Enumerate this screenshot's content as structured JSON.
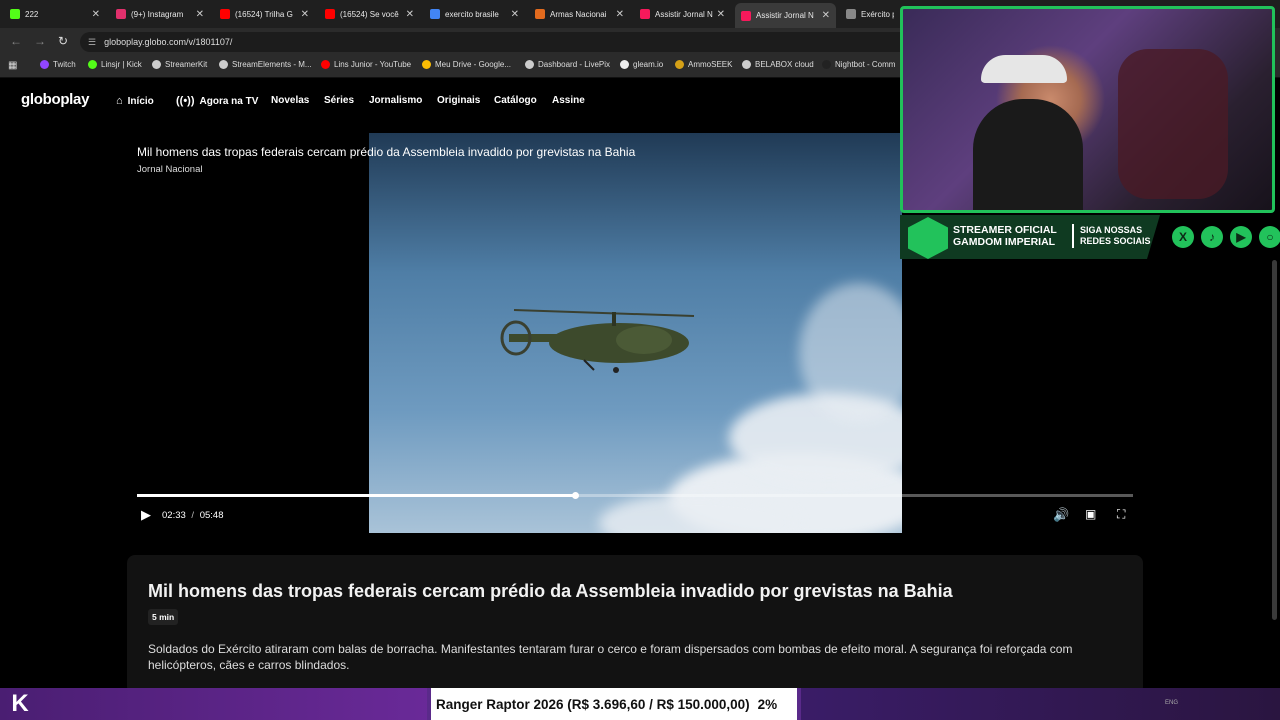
{
  "browser": {
    "tabs": [
      {
        "title": "222",
        "color": "#53fc18",
        "active": false
      },
      {
        "title": "(9+) Instagram",
        "color": "#e1306c",
        "active": false
      },
      {
        "title": "(16524) Trilha G",
        "color": "#ff0000",
        "active": false
      },
      {
        "title": "(16524) Se você",
        "color": "#ff0000",
        "active": false
      },
      {
        "title": "exercito brasile",
        "color": "#4285f4",
        "active": false
      },
      {
        "title": "Armas Nacionai",
        "color": "#e36b1e",
        "active": false
      },
      {
        "title": "Assistir Jornal N",
        "color": "#f7195b",
        "active": false
      },
      {
        "title": "Assistir Jornal N",
        "color": "#f7195b",
        "active": true
      },
      {
        "title": "Exército pa",
        "color": "#888888",
        "active": false
      }
    ],
    "url": "globoplay.globo.com/v/1801107/",
    "bookmarks": [
      {
        "label": "Twitch",
        "color": "#9146ff"
      },
      {
        "label": "Linsjr | Kick",
        "color": "#53fc18"
      },
      {
        "label": "StreamerKit",
        "color": "#cccccc"
      },
      {
        "label": "StreamElements - M...",
        "color": "#cccccc"
      },
      {
        "label": "Lins Junior - YouTube",
        "color": "#ff0000"
      },
      {
        "label": "Meu Drive - Google...",
        "color": "#fbbc04"
      },
      {
        "label": "Dashboard - LivePix",
        "color": "#cccccc"
      },
      {
        "label": "gleam.io",
        "color": "#eeeeee"
      },
      {
        "label": "AmmoSEEK",
        "color": "#d4a017"
      },
      {
        "label": "BELABOX cloud",
        "color": "#cccccc"
      },
      {
        "label": "Nightbot - Comm",
        "color": "#222222"
      }
    ]
  },
  "site": {
    "logo": "globoplay",
    "nav": [
      {
        "label": "Início",
        "icon": "home-icon"
      },
      {
        "label": "Agora na TV",
        "icon": "broadcast-icon"
      },
      {
        "label": "Novelas"
      },
      {
        "label": "Séries"
      },
      {
        "label": "Jornalismo"
      },
      {
        "label": "Originais"
      },
      {
        "label": "Catálogo"
      },
      {
        "label": "Assine"
      }
    ]
  },
  "player": {
    "title": "Mil homens das tropas federais cercam prédio da Assembleia invadido por grevistas na Bahia",
    "program": "Jornal Nacional",
    "current_time": "02:33",
    "separator": "/",
    "duration": "05:48",
    "progress": 0.44
  },
  "details": {
    "title": "Mil homens das tropas federais cercam prédio da Assembleia invadido por grevistas na Bahia",
    "duration_badge": "5 min",
    "description": "Soldados do Exército atiraram com balas de borracha. Manifestantes tentaram furar o cerco e foram dispersados com bombas de efeito moral. A segurança foi reforçada com helicópteros, cães e carros blindados."
  },
  "overlay": {
    "banner_line1": "STREAMER OFICIAL",
    "banner_line2": "GAMDOM IMPERIAL",
    "banner_line3": "SIGA NOSSAS",
    "banner_line4": "REDES SOCIAIS",
    "socials": [
      "x-icon",
      "tiktok-icon",
      "youtube-icon",
      "instagram-icon"
    ],
    "accent": "#22c25b",
    "ticker_item": "Ranger Raptor 2026 (R$ 3.696,60 / R$ 150.000,00)",
    "ticker_percent": "2%"
  },
  "taskbar": {
    "lang": "ENG"
  }
}
